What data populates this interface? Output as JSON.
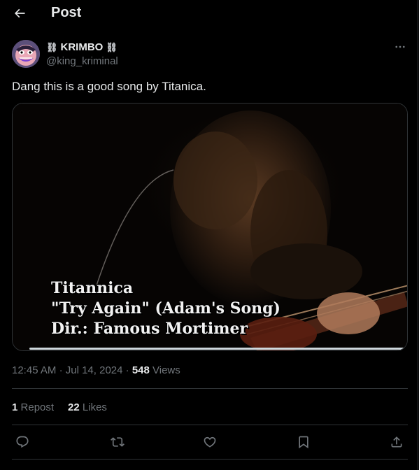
{
  "header": {
    "title": "Post",
    "back_icon": "arrow-left-icon"
  },
  "author": {
    "display_name": "KRIMBO",
    "chain_glyph": "⛓",
    "handle": "@king_kriminal",
    "avatar_icon": "cartoon-avatar"
  },
  "post": {
    "text": "Dang this is a good song by Titanica.",
    "media": {
      "caption_line1": "Titannica",
      "caption_line2": "\"Try Again\" (Adam's Song)",
      "caption_line3": "Dir.: Famous Mortimer",
      "progress": 1.0
    },
    "time": "12:45 AM",
    "date": "Jul 14, 2024",
    "sep": "·",
    "views_count": "548",
    "views_label": "Views"
  },
  "stats": {
    "reposts_count": "1",
    "reposts_label": "Repost",
    "likes_count": "22",
    "likes_label": "Likes"
  },
  "actions": [
    "reply-icon",
    "repost-icon",
    "like-icon",
    "bookmark-icon",
    "share-icon"
  ],
  "colors": {
    "background": "#000000",
    "text": "#e7e9ea",
    "secondary": "#71767b",
    "border": "#2f3336"
  }
}
